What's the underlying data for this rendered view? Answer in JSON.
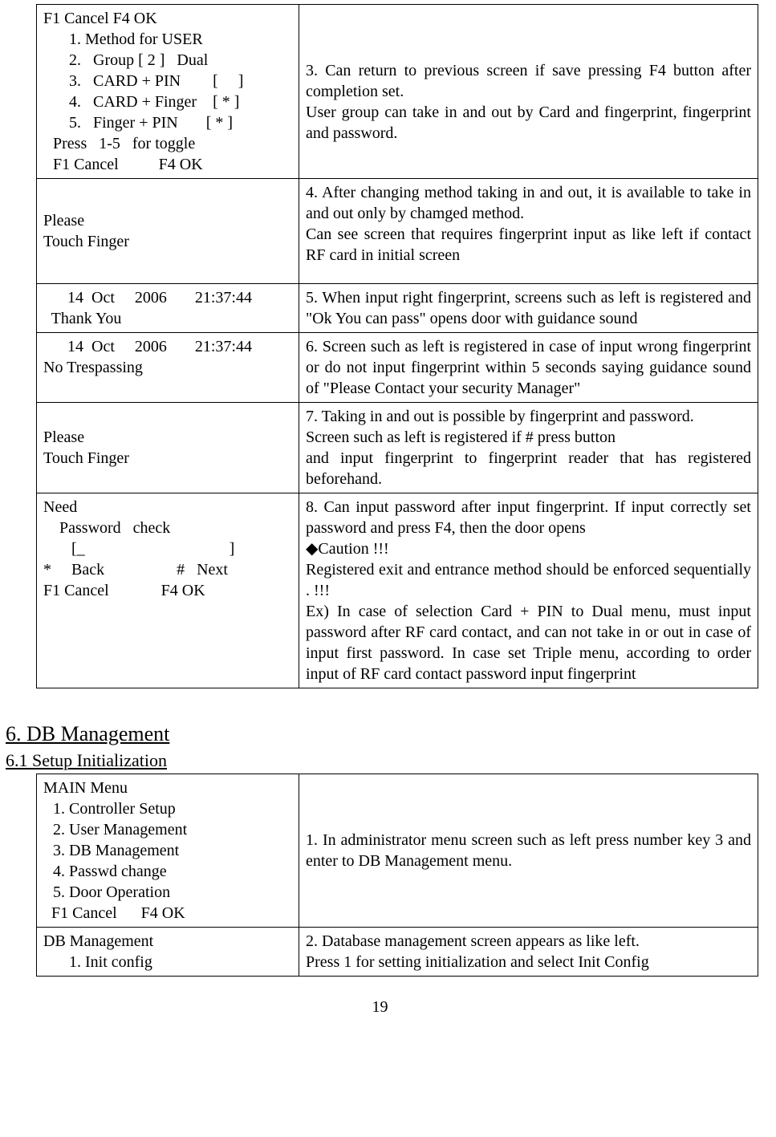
{
  "page_number": "19",
  "section5": {
    "rows": [
      {
        "left": {
          "header_line": "F1 Cancel          F4 OK",
          "items": [
            "1.   Method for USER",
            "2.   Group [ 2 ]   Dual",
            "3.   CARD + PIN        [     ]",
            "4.   CARD + Finger    [ * ]",
            "5.   Finger + PIN       [ * ]"
          ],
          "footer1": "Press   1-5   for toggle",
          "footer2": "F1 Cancel          F4 OK"
        },
        "right": "3. Can return to previous screen if save pressing F4 button after completion set.\nUser group can take in and out by Card and fingerprint, fingerprint and password."
      },
      {
        "left": {
          "line1": "Please",
          "line2": "Touch Finger"
        },
        "right": "4. After changing method taking in and out, it is available to take in and out only by chamged method.\nCan see screen that requires fingerprint input as like left if contact RF card in initial screen"
      },
      {
        "left": {
          "line1": "      14  Oct     2006       21:37:44",
          "line2": "",
          "line3": "  Thank You"
        },
        "right": "5. When input right fingerprint, screens such as left is registered and \"Ok You can pass\" opens door with guidance sound"
      },
      {
        "left": {
          "line1": "      14  Oct     2006       21:37:44",
          "line2": "",
          "line3": "No Trespassing"
        },
        "right": "6. Screen such as left is registered in case of input wrong fingerprint or do not input fingerprint within 5 seconds saying guidance sound of \"Please Contact your security Manager\""
      },
      {
        "left": {
          "line1": "Please",
          "line2": "Touch Finger"
        },
        "right": "7. Taking in and out is possible by fingerprint and password.\nScreen such as left is registered if # press button\nand input fingerprint to fingerprint reader that has registered beforehand."
      },
      {
        "left": {
          "line0": "",
          "line1": "Need",
          "line2": "    Password   check",
          "line3": "",
          "line4": "       [_                                    ]",
          "line5": "",
          "line6": "*     Back                  #   Next",
          "line7": "F1 Cancel             F4 OK"
        },
        "right": {
          "line1": "   8. Can input password after input fingerprint. If input correctly set password and press F4, then the door opens",
          "line2": "   ◆Caution !!!",
          "line3": "   Registered exit and entrance method should be       enforced sequentially . !!!",
          "line4": "     Ex) In case of selection Card + PIN to Dual menu, must input password after RF card contact, and can not take in or out in case of input first password. In case set Triple menu, according to order input of RF card contact password input fingerprint"
        }
      }
    ]
  },
  "section6": {
    "heading": "6. DB Management",
    "sub": "6.1 Setup Initialization",
    "rows": [
      {
        "left": {
          "title": "MAIN Menu",
          "items": [
            "1.   Controller Setup",
            "2.   User Management",
            "3.   DB Management",
            "4.   Passwd change",
            "5.   Door Operation"
          ],
          "footer": "  F1 Cancel      F4 OK"
        },
        "right": "1. In administrator menu screen such as left press number key 3 and enter to DB Management menu."
      },
      {
        "left": {
          "title": "DB Management",
          "items": [
            "1.   Init config"
          ]
        },
        "right": "2. Database management screen appears as like left.\nPress 1 for setting initialization and select Init Config"
      }
    ]
  }
}
